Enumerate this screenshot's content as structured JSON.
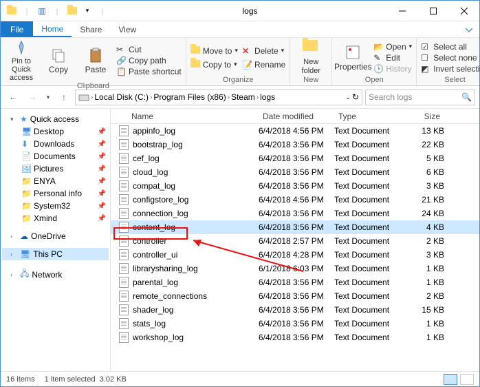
{
  "window": {
    "title": "logs"
  },
  "tabs": {
    "file": "File",
    "home": "Home",
    "share": "Share",
    "view": "View"
  },
  "ribbon": {
    "clipboard": {
      "label": "Clipboard",
      "pin": "Pin to Quick\naccess",
      "copy": "Copy",
      "paste": "Paste",
      "cut": "Cut",
      "copypath": "Copy path",
      "pasteshortcut": "Paste shortcut"
    },
    "organize": {
      "label": "Organize",
      "moveto": "Move to",
      "copyto": "Copy to",
      "delete": "Delete",
      "rename": "Rename"
    },
    "new": {
      "label": "New",
      "newfolder": "New\nfolder"
    },
    "open": {
      "label": "Open",
      "properties": "Properties",
      "open": "Open",
      "edit": "Edit",
      "history": "History"
    },
    "select": {
      "label": "Select",
      "selectall": "Select all",
      "selectnone": "Select none",
      "invert": "Invert selection"
    }
  },
  "breadcrumb": {
    "segments": [
      "Local Disk (C:)",
      "Program Files (x86)",
      "Steam",
      "logs"
    ]
  },
  "search": {
    "placeholder": "Search logs"
  },
  "sidebar": {
    "quickaccess": "Quick access",
    "items": [
      {
        "label": "Desktop",
        "pinned": true
      },
      {
        "label": "Downloads",
        "pinned": true
      },
      {
        "label": "Documents",
        "pinned": true
      },
      {
        "label": "Pictures",
        "pinned": true
      },
      {
        "label": "ENYA",
        "pinned": true
      },
      {
        "label": "Personal info",
        "pinned": true
      },
      {
        "label": "System32",
        "pinned": true
      },
      {
        "label": "Xmind",
        "pinned": true
      }
    ],
    "onedrive": "OneDrive",
    "thispc": "This PC",
    "network": "Network"
  },
  "columns": {
    "name": "Name",
    "date": "Date modified",
    "type": "Type",
    "size": "Size"
  },
  "files": [
    {
      "name": "appinfo_log",
      "date": "6/4/2018 4:56 PM",
      "type": "Text Document",
      "size": "13 KB"
    },
    {
      "name": "bootstrap_log",
      "date": "6/4/2018 3:56 PM",
      "type": "Text Document",
      "size": "22 KB"
    },
    {
      "name": "cef_log",
      "date": "6/4/2018 3:56 PM",
      "type": "Text Document",
      "size": "5 KB"
    },
    {
      "name": "cloud_log",
      "date": "6/4/2018 3:56 PM",
      "type": "Text Document",
      "size": "6 KB"
    },
    {
      "name": "compat_log",
      "date": "6/4/2018 3:56 PM",
      "type": "Text Document",
      "size": "3 KB"
    },
    {
      "name": "configstore_log",
      "date": "6/4/2018 4:56 PM",
      "type": "Text Document",
      "size": "21 KB"
    },
    {
      "name": "connection_log",
      "date": "6/4/2018 3:56 PM",
      "type": "Text Document",
      "size": "24 KB"
    },
    {
      "name": "content_log",
      "date": "6/4/2018 3:56 PM",
      "type": "Text Document",
      "size": "4 KB",
      "selected": true
    },
    {
      "name": "controller",
      "date": "6/4/2018 2:57 PM",
      "type": "Text Document",
      "size": "2 KB"
    },
    {
      "name": "controller_ui",
      "date": "6/4/2018 4:28 PM",
      "type": "Text Document",
      "size": "3 KB"
    },
    {
      "name": "librarysharing_log",
      "date": "6/1/2018 6:03 PM",
      "type": "Text Document",
      "size": "1 KB"
    },
    {
      "name": "parental_log",
      "date": "6/4/2018 3:56 PM",
      "type": "Text Document",
      "size": "1 KB"
    },
    {
      "name": "remote_connections",
      "date": "6/4/2018 3:56 PM",
      "type": "Text Document",
      "size": "2 KB"
    },
    {
      "name": "shader_log",
      "date": "6/4/2018 3:56 PM",
      "type": "Text Document",
      "size": "15 KB"
    },
    {
      "name": "stats_log",
      "date": "6/4/2018 3:56 PM",
      "type": "Text Document",
      "size": "1 KB"
    },
    {
      "name": "workshop_log",
      "date": "6/4/2018 3:56 PM",
      "type": "Text Document",
      "size": "1 KB"
    }
  ],
  "status": {
    "count": "16 items",
    "selected": "1 item selected",
    "size": "3.02 KB"
  }
}
